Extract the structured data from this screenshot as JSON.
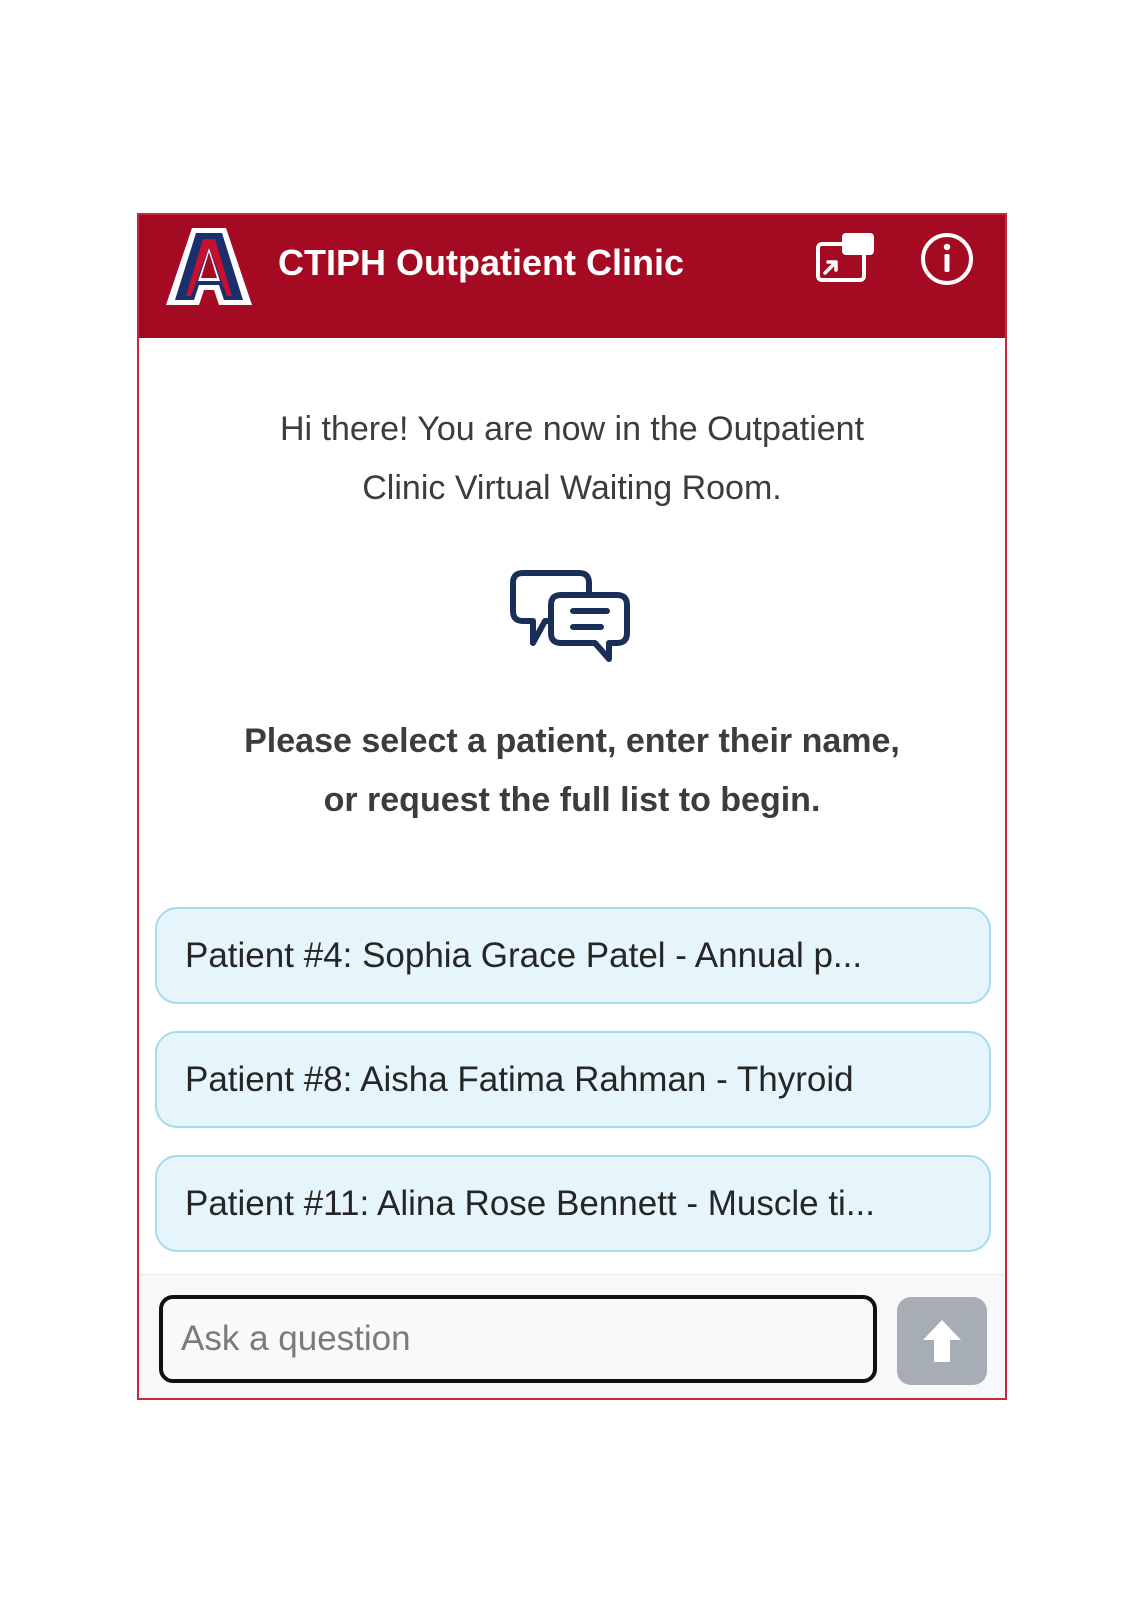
{
  "header": {
    "title": "CTIPH Outpatient Clinic",
    "logo_letter": "A",
    "logo_icon": "university-a-logo",
    "popout_icon": "popout-window-icon",
    "info_icon": "info-icon"
  },
  "welcome": {
    "line1": "Hi there! You are now in the Outpatient",
    "line2": "Clinic Virtual Waiting Room.",
    "icon": "chat-bubbles-icon"
  },
  "prompt": {
    "line1": "Please select a patient, enter their name,",
    "line2": "or request the full list to begin."
  },
  "patients": [
    {
      "label": "Patient #4: Sophia Grace Patel - Annual p..."
    },
    {
      "label": "Patient #8: Aisha Fatima Rahman - Thyroid"
    },
    {
      "label": "Patient #11: Alina Rose Bennett - Muscle ti..."
    }
  ],
  "input": {
    "placeholder": "Ask a question",
    "value": "",
    "send_icon": "arrow-up-icon"
  },
  "colors": {
    "header_bg": "#a50a23",
    "logo_blue": "#1a2f6b",
    "chip_bg": "#e6f5fb",
    "chip_border": "#a6dbee",
    "send_bg": "#a7adb4"
  }
}
